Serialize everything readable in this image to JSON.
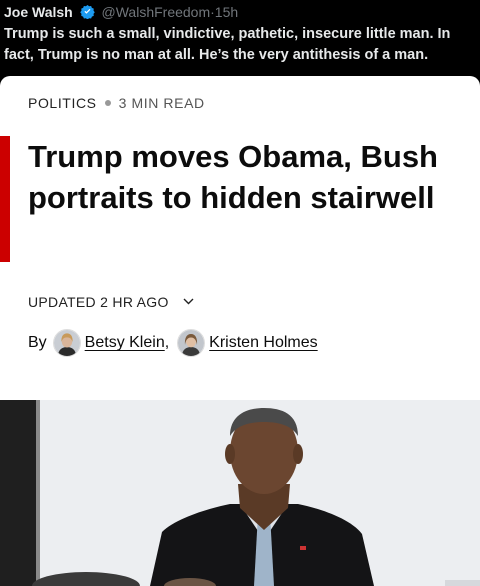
{
  "tweet": {
    "author": "Joe Walsh",
    "handle": "@WalshFreedom",
    "separator": "·",
    "time": "15h",
    "text": "Trump is such a small, vindictive, pathetic, insecure little man. In fact, Trump is no man at all. He’s the very antithesis of a man."
  },
  "article": {
    "section": "POLITICS",
    "read_time": "3 MIN READ",
    "headline": "Trump moves Obama, Bush portraits to hidden stairwell",
    "updated": "UPDATED 2 HR AGO",
    "byline_prefix": "By",
    "authors": [
      {
        "name": "Betsy Klein",
        "suffix": ","
      },
      {
        "name": "Kristen Holmes",
        "suffix": ""
      }
    ]
  },
  "colors": {
    "accent": "#cc0000",
    "verified": "#1d9bf0"
  }
}
